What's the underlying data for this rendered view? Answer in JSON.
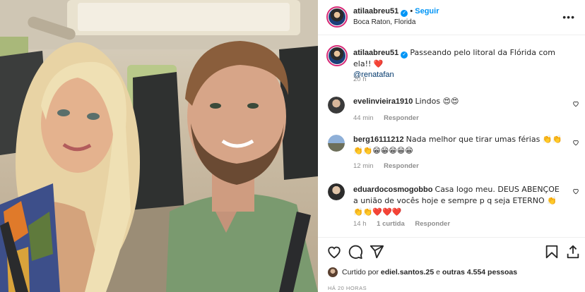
{
  "post": {
    "author": "atilaabreu51",
    "follow_label": "Seguir",
    "separator": "•",
    "location": "Boca Raton, Florida",
    "more_icon": "more-horizontal-icon"
  },
  "caption": {
    "author": "atilaabreu51",
    "text": "Passeando pelo litoral da Flórida com ela!! ❤️",
    "mention": "@renatafan",
    "time": "20 h"
  },
  "comments": [
    {
      "user": "evelinvieira1910",
      "text": "Lindos 😍😍",
      "time": "44 min",
      "reply_label": "Responder",
      "likes": ""
    },
    {
      "user": "berg16111212",
      "text": "Nada melhor que tirar umas férias 👏👏👏👏😁😁😁😁😁",
      "time": "12 min",
      "reply_label": "Responder",
      "likes": ""
    },
    {
      "user": "eduardocosmogobbo",
      "text": "Casa logo meu. DEUS ABENÇOE a união de vocês hoje e sempre p q seja ETERNO 👏👏👏❤️❤️❤️",
      "time": "14 h",
      "likes": "1 curtida",
      "reply_label": "Responder"
    }
  ],
  "likes": {
    "prefix": "Curtido por",
    "user": "ediel.santos.25",
    "middle": "e",
    "others": "outras 4.554 pessoas"
  },
  "timestamp": "HÁ 20 HORAS",
  "icons": {
    "like": "heart-icon",
    "comment": "comment-icon",
    "share": "send-icon",
    "save": "bookmark-icon",
    "upload": "upload-icon"
  },
  "colors": {
    "link": "#0095f6",
    "heart": "#ed4956",
    "ring": "#d62976",
    "muted": "#8e8e8e"
  }
}
